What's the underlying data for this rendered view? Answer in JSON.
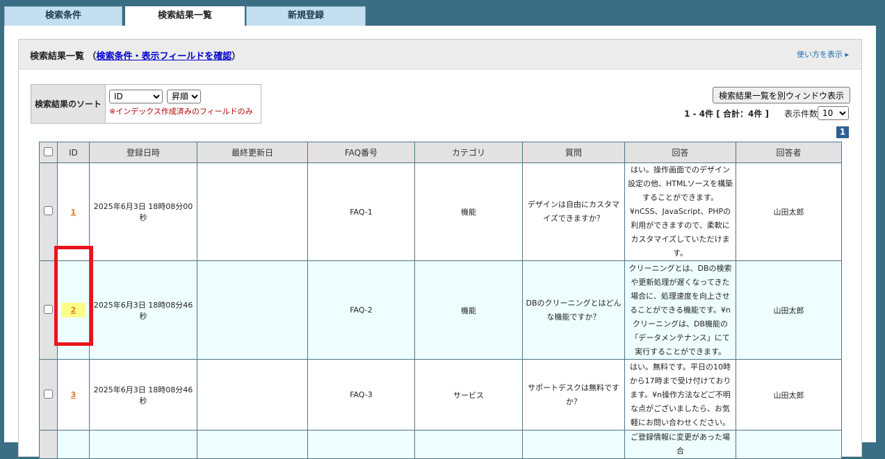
{
  "tabs": [
    {
      "label": "検索条件"
    },
    {
      "label": "検索結果一覧"
    },
    {
      "label": "新規登録"
    }
  ],
  "header": {
    "title_prefix": "検索結果一覧 （",
    "title_link": "検索条件・表示フィールドを確認",
    "title_suffix": "）",
    "help_link": "使い方を表示 ▸"
  },
  "sort": {
    "label": "検索結果のソート",
    "field_options": [
      "ID"
    ],
    "order_options": [
      "昇順"
    ],
    "note": "※インデックス作成済みのフィールドのみ"
  },
  "actions": {
    "open_window_label": "検索結果一覧を別ウィンドウ表示"
  },
  "summary": {
    "count_text": "1 - 4件 [ 合計：4件 ]",
    "per_page_label": "表示件数",
    "per_page_options": [
      "10"
    ]
  },
  "pagination": {
    "current_page": "1"
  },
  "table": {
    "columns": [
      "ID",
      "登録日時",
      "最終更新日",
      "FAQ番号",
      "カテゴリ",
      "質問",
      "回答",
      "回答者"
    ],
    "rows": [
      {
        "id": "1",
        "created": "2025年6月3日 18時08分00秒",
        "updated": "",
        "faq_no": "FAQ-1",
        "category": "機能",
        "question": "デザインは自由にカスタマイズできますか？",
        "answer": "はい。操作画面でのデザイン設定の他、HTMLソースを構築することができます。¥nCSS、JavaScript、PHPの利用ができますので、柔軟にカスタマイズしていただけます。",
        "responder": "山田太郎"
      },
      {
        "id": "2",
        "created": "2025年6月3日 18時08分46秒",
        "updated": "",
        "faq_no": "FAQ-2",
        "category": "機能",
        "question": "DBのクリーニングとはどんな機能ですか？",
        "answer": "クリーニングとは、DBの検索や更新処理が遅くなってきた場合に、処理速度を向上させることができる機能です。¥nクリーニングは、DB機能の「データメンテナンス」にて実行することができます。",
        "responder": "山田太郎"
      },
      {
        "id": "3",
        "created": "2025年6月3日 18時08分46秒",
        "updated": "",
        "faq_no": "FAQ-3",
        "category": "サービス",
        "question": "サポートデスクは無料ですか？",
        "answer": "はい。無料です。平日の10時から17時まで受け付けております。¥n操作方法などご不明な点がございましたら、お気軽にお問い合わせください。",
        "responder": "山田太郎"
      },
      {
        "id": "",
        "created": "",
        "updated": "",
        "faq_no": "",
        "category": "",
        "question": "",
        "answer": "ご登録情報に変更があった場合",
        "responder": ""
      }
    ]
  },
  "colors": {
    "frame_bg": "#3a6e84",
    "tab_bg": "#c3dff0",
    "alt_row_bg": "#eefefe",
    "id_link": "#e0761e",
    "highlight": "#ffff88",
    "annotation_box": "#e8141e"
  }
}
